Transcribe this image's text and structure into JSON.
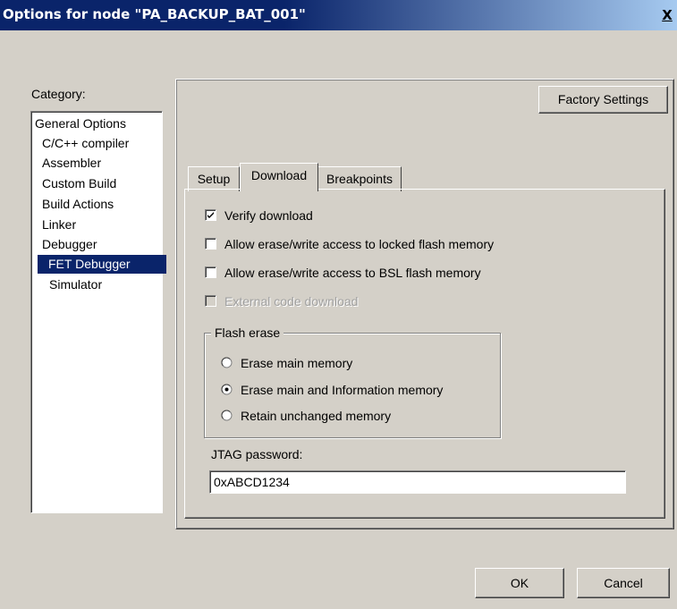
{
  "window": {
    "title": "Options for node \"PA_BACKUP_BAT_001\"",
    "close_label": "X"
  },
  "category": {
    "label": "Category:",
    "items": [
      {
        "label": "General Options",
        "selected": false
      },
      {
        "label": "C/C++ compiler",
        "selected": false
      },
      {
        "label": "Assembler",
        "selected": false
      },
      {
        "label": "Custom Build",
        "selected": false
      },
      {
        "label": "Build Actions",
        "selected": false
      },
      {
        "label": "Linker",
        "selected": false
      },
      {
        "label": "Debugger",
        "selected": false
      },
      {
        "label": "FET Debugger",
        "selected": true
      },
      {
        "label": "Simulator",
        "selected": false
      }
    ]
  },
  "buttons": {
    "factory_settings": "Factory Settings",
    "ok": "OK",
    "cancel": "Cancel"
  },
  "tabs": [
    {
      "label": "Setup",
      "active": false
    },
    {
      "label": "Download",
      "active": true
    },
    {
      "label": "Breakpoints",
      "active": false
    }
  ],
  "download": {
    "options": [
      {
        "label": "Verify download",
        "checked": true,
        "enabled": true
      },
      {
        "label": "Allow erase/write access to locked flash memory",
        "checked": false,
        "enabled": true
      },
      {
        "label": "Allow erase/write access to BSL flash memory",
        "checked": false,
        "enabled": true
      },
      {
        "label": "External code download",
        "checked": false,
        "enabled": false
      }
    ],
    "flash_erase": {
      "title": "Flash erase",
      "options": [
        {
          "label": "Erase main memory",
          "selected": false
        },
        {
          "label": "Erase main and Information memory",
          "selected": true
        },
        {
          "label": "Retain unchanged memory",
          "selected": false
        }
      ]
    },
    "jtag": {
      "label": "JTAG password:",
      "value": "0xABCD1234"
    }
  },
  "colors": {
    "dialog_bg": "#d4d0c8",
    "title_bar": "#0a246a",
    "selection": "#0a246a"
  }
}
